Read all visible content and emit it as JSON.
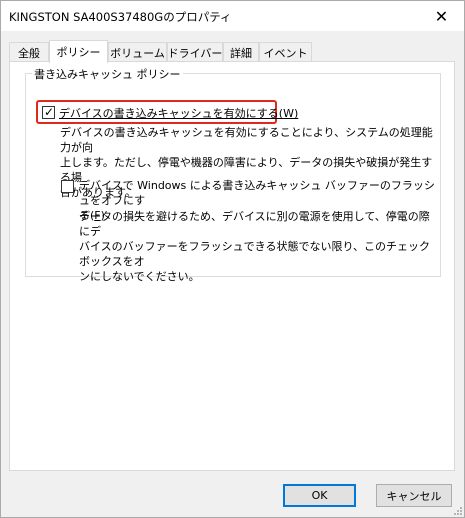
{
  "window": {
    "title": "KINGSTON SA400S37480Gのプロパティ",
    "close_glyph": "✕"
  },
  "tabs": [
    {
      "label": "全般"
    },
    {
      "label": "ポリシー"
    },
    {
      "label": "ボリューム"
    },
    {
      "label": "ドライバー"
    },
    {
      "label": "詳細"
    },
    {
      "label": "イベント"
    }
  ],
  "active_tab": "ポリシー",
  "write_cache_policy": {
    "group_label": "書き込みキャッシュ ポリシー",
    "enable_cache": {
      "label": "デバイスの書き込みキャッシュを有効にする(",
      "access_key": "W",
      "label_end": ")",
      "checked": true,
      "description_lines": [
        "デバイスの書き込みキャッシュを有効にすることにより、システムの処理能力が向",
        "上します。ただし、停電や機器の障害により、データの損失や破損が発生する場",
        "合があります。"
      ]
    },
    "disable_flush": {
      "label_line1": "デバイスで Windows による書き込みキャッシュ バッファーのフラッシュをオフにす",
      "label_line2_pre": "る(",
      "access_key": "F",
      "label_end": ")",
      "checked": false,
      "description_lines": [
        "データの損失を避けるため、デバイスに別の電源を使用して、停電の際にデ",
        "バイスのバッファーをフラッシュできる状態でない限り、このチェック ボックスをオ",
        "ンにしないでください。"
      ]
    }
  },
  "buttons": {
    "ok": "OK",
    "cancel": "キャンセル"
  },
  "colors": {
    "highlight_border": "#e0281f",
    "default_button_border": "#0078d7"
  }
}
